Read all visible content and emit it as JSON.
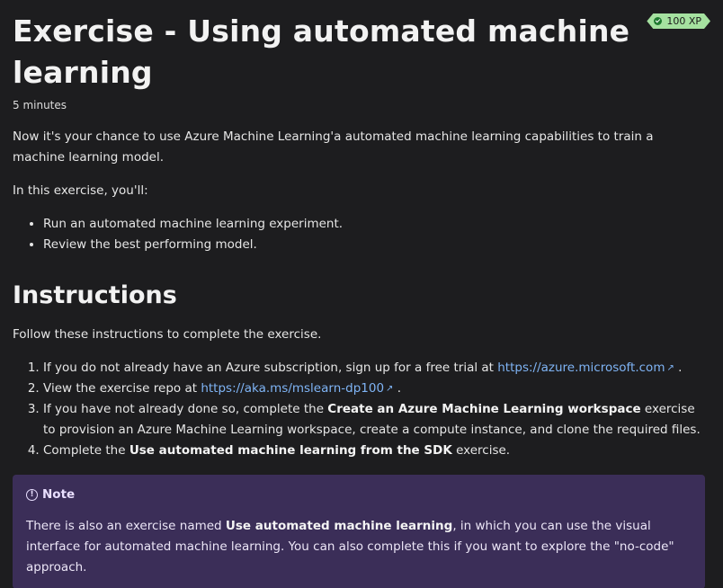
{
  "xp": {
    "label": "100 XP"
  },
  "title": "Exercise - Using automated machine learning",
  "duration": "5 minutes",
  "intro": "Now it's your chance to use Azure Machine Learning'a automated machine learning capabilities to train a machine learning model.",
  "in_exercise": "In this exercise, you'll:",
  "bullets": [
    "Run an automated machine learning experiment.",
    "Review the best performing model."
  ],
  "instructions": {
    "heading": "Instructions",
    "follow": "Follow these instructions to complete the exercise.",
    "steps": [
      {
        "pre": "If you do not already have an Azure subscription, sign up for a free trial at ",
        "link": "https://azure.microsoft.com",
        "post": "."
      },
      {
        "pre": "View the exercise repo at ",
        "link": "https://aka.ms/mslearn-dp100",
        "post": "."
      },
      {
        "pre": "If you have not already done so, complete the ",
        "bold": "Create an Azure Machine Learning workspace",
        "post": " exercise to provision an Azure Machine Learning workspace, create a compute instance, and clone the required files."
      },
      {
        "pre": "Complete the ",
        "bold": "Use automated machine learning from the SDK",
        "post": " exercise."
      }
    ]
  },
  "note": {
    "heading": "Note",
    "pre": "There is also an exercise named ",
    "bold": "Use automated machine learning",
    "post": ", in which you can use the visual interface for automated machine learning. You can also complete this if you want to explore the \"no-code\" approach."
  },
  "icons": {
    "xp": "checkmark-circle-icon",
    "external": "external-link-icon",
    "note": "info-circle-icon"
  },
  "colors": {
    "background": "#1d1d1f",
    "link": "#7fb4f5",
    "note_background": "#3b2e58",
    "xp_badge": "#a5e1a0"
  }
}
